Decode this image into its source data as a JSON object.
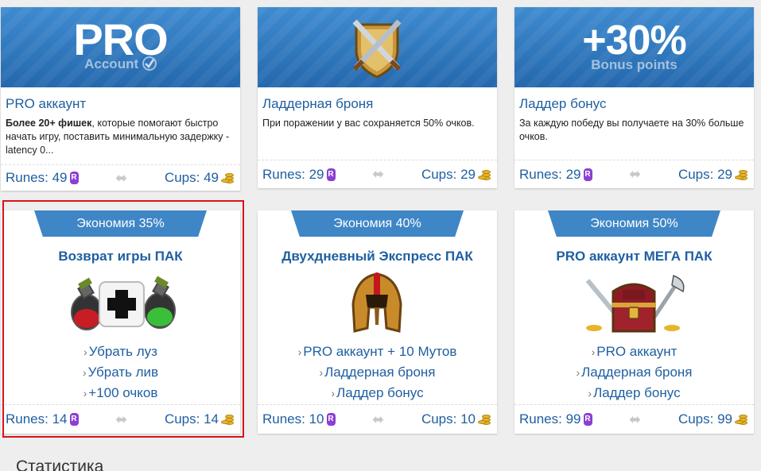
{
  "cards": [
    {
      "banner_big": "PRO",
      "banner_sub": "Account",
      "title": "PRO аккаунт",
      "desc_bold": "Более 20+ фишек",
      "desc_rest": ", которые помогают быстро начать игру, поставить минимальную задержку -latency 0...",
      "runes_label": "Runes: 49",
      "cups_label": "Cups: 49"
    },
    {
      "title": "Ладдерная броня",
      "desc": "При поражении у вас сохраняется 50% очков.",
      "runes_label": "Runes: 29",
      "cups_label": "Cups: 29"
    },
    {
      "banner_big": "+30%",
      "banner_sub": "Bonus points",
      "title": "Ладдер бонус",
      "desc": "За каждую победу вы получаете на 30% больше очков.",
      "runes_label": "Runes: 29",
      "cups_label": "Cups: 29"
    }
  ],
  "packs": [
    {
      "ribbon": "Экономия 35%",
      "title": "Возврат игры ПАК",
      "features": [
        "Убрать луз",
        "Убрать лив",
        "+100 очков"
      ],
      "runes_label": "Runes: 14",
      "cups_label": "Cups: 14"
    },
    {
      "ribbon": "Экономия 40%",
      "title": "Двухдневный Экспресс ПАК",
      "features": [
        "PRO аккаунт + 10 Мутов",
        "Ладдерная броня",
        "Ладдер бонус"
      ],
      "runes_label": "Runes: 10",
      "cups_label": "Cups: 10"
    },
    {
      "ribbon": "Экономия 50%",
      "title": "PRO аккаунт МЕГА ПАК",
      "features": [
        "PRO аккаунт",
        "Ладдерная броня",
        "Ладдер бонус"
      ],
      "runes_label": "Runes: 99",
      "cups_label": "Cups: 99"
    }
  ],
  "rune_glyph": "R",
  "arrows_glyph": "⬌",
  "chevron_glyph": "›",
  "plus_glyph": "+",
  "stats_heading": "Статистика",
  "colors": {
    "link_blue": "#1f5fa1",
    "banner_blue": "#2f78bf",
    "ribbon_blue": "#3f86c6",
    "rune_purple": "#8c3fd1",
    "highlight_red": "#d7141b"
  }
}
